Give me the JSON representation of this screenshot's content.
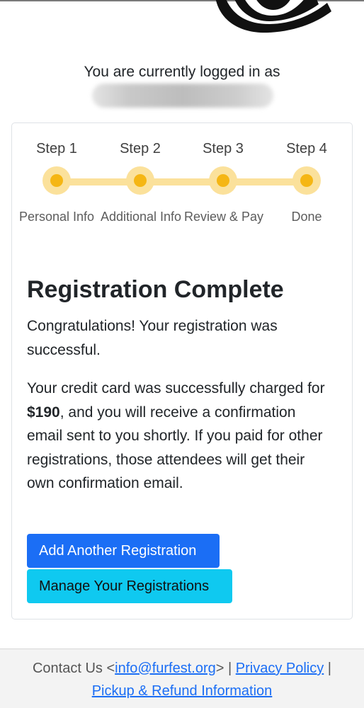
{
  "login": {
    "label": "You are currently logged in as",
    "username": ""
  },
  "steps": [
    {
      "title": "Step 1",
      "label": "Personal Info"
    },
    {
      "title": "Step 2",
      "label": "Additional Info"
    },
    {
      "title": "Step 3",
      "label": "Review & Pay"
    },
    {
      "title": "Step 4",
      "label": "Done"
    }
  ],
  "content": {
    "heading": "Registration Complete",
    "congrats": "Congratulations! Your registration was successful.",
    "charge_prefix": "Your credit card was successfully charged for ",
    "charge_amount": "$190",
    "charge_suffix": ", and you will receive a confirmation email sent to you shortly. If you paid for other registrations, those attendees will get their own confirmation email."
  },
  "buttons": {
    "add_another": "Add Another Registration",
    "manage": "Manage Your Registrations"
  },
  "footer": {
    "contact_prefix": "Contact Us <",
    "email": "info@furfest.org",
    "contact_suffix": "> | ",
    "privacy": "Privacy Policy",
    "sep": " |",
    "pickup": "Pickup & Refund Information"
  },
  "colors": {
    "primary": "#1b6ef5",
    "info": "#0fc9f0",
    "step_dot": "#f5b614",
    "step_track": "#fbe19b"
  }
}
